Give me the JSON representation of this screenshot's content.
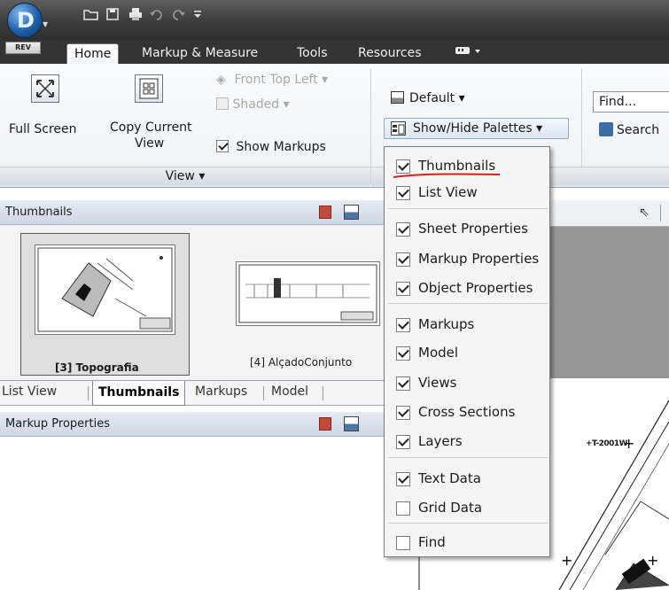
{
  "app": {
    "logo_letter": "D",
    "logo_text": "REV"
  },
  "quick_access": [
    "open-icon",
    "save-icon",
    "print-icon",
    "undo-icon",
    "redo-icon",
    "customize-dropdown-icon"
  ],
  "tabs": [
    {
      "label": "Home",
      "active": true
    },
    {
      "label": "Markup & Measure",
      "active": false
    },
    {
      "label": "Tools",
      "active": false
    },
    {
      "label": "Resources",
      "active": false
    }
  ],
  "ribbon": {
    "full_screen": "Full Screen",
    "copy_view_line1": "Copy Current",
    "copy_view_line2": "View",
    "front_top_left": "Front Top Left",
    "shaded": "Shaded",
    "show_markups": "Show Markups",
    "view_panel": "View",
    "default": "Default",
    "show_hide_palettes": "Show/Hide Palettes",
    "find_placeholder": "Find...",
    "search": "Search"
  },
  "thumbnails_palette": {
    "title": "Thumbnails",
    "items": [
      {
        "caption": "[3] Topografia",
        "selected": true
      },
      {
        "caption": "[4] AlçadoConjunto",
        "selected": false
      }
    ]
  },
  "palette_tabs": [
    "List View",
    "Thumbnails",
    "Markups",
    "Model"
  ],
  "markup_properties": {
    "title": "Markup Properties"
  },
  "menu": {
    "groups": [
      [
        {
          "label": "Thumbnails",
          "checked": true
        },
        {
          "label": "List View",
          "checked": true
        }
      ],
      [
        {
          "label": "Sheet Properties",
          "checked": true
        },
        {
          "label": "Markup Properties",
          "checked": true
        },
        {
          "label": "Object Properties",
          "checked": true
        }
      ],
      [
        {
          "label": "Markups",
          "checked": true
        },
        {
          "label": "Model",
          "checked": true
        },
        {
          "label": "Views",
          "checked": true
        },
        {
          "label": "Cross Sections",
          "checked": true
        },
        {
          "label": "Layers",
          "checked": true
        }
      ],
      [
        {
          "label": "Text Data",
          "checked": true
        },
        {
          "label": "Grid Data",
          "checked": false
        }
      ],
      [
        {
          "label": "Find",
          "checked": false
        }
      ]
    ]
  },
  "canvas": {
    "label_text": "+T-2001W"
  },
  "colors": {
    "accent_blue": "#1f5fa8",
    "title_bar": "#3c3c3c",
    "annotation_red": "#d42020"
  }
}
